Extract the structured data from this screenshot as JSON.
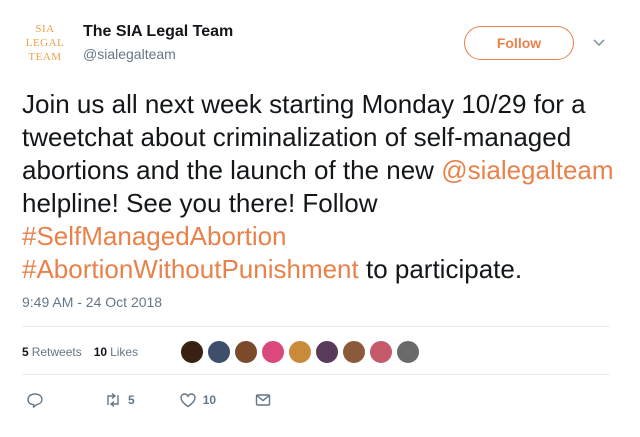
{
  "header": {
    "logo_lines": [
      "SIA",
      "LEGAL",
      "TEAM"
    ],
    "display_name": "The SIA Legal Team",
    "handle": "@sialegalteam",
    "follow_label": "Follow"
  },
  "tweet": {
    "parts": [
      {
        "text": "Join us all next week starting Monday 10/29 for a tweetchat about criminalization of self-managed abortions and the launch of the new ",
        "link": false
      },
      {
        "text": "@sialegalteam",
        "link": true
      },
      {
        "text": " helpline! See you there! Follow ",
        "link": false
      },
      {
        "text": "#SelfManagedAbortion",
        "link": true
      },
      {
        "text": " ",
        "link": false
      },
      {
        "text": "#AbortionWithoutPunishment",
        "link": true
      },
      {
        "text": " to participate.",
        "link": false
      }
    ],
    "timestamp": "9:49 AM - 24 Oct 2018"
  },
  "stats": {
    "retweets_count": "5",
    "retweets_label": "Retweets",
    "likes_count": "10",
    "likes_label": "Likes",
    "liker_avatar_colors": [
      "#3a1f14",
      "#3d4f6b",
      "#7a4a2a",
      "#d94a7a",
      "#c98a3a",
      "#5a3a5a",
      "#8a5a3a",
      "#c45a6a",
      "#6a6a6a"
    ]
  },
  "actions": {
    "reply_count": "",
    "retweet_count": "5",
    "like_count": "10"
  },
  "colors": {
    "accent": "#e8824a",
    "logo": "#e8a24a",
    "muted": "#657786",
    "divider": "#e6ecf0"
  }
}
